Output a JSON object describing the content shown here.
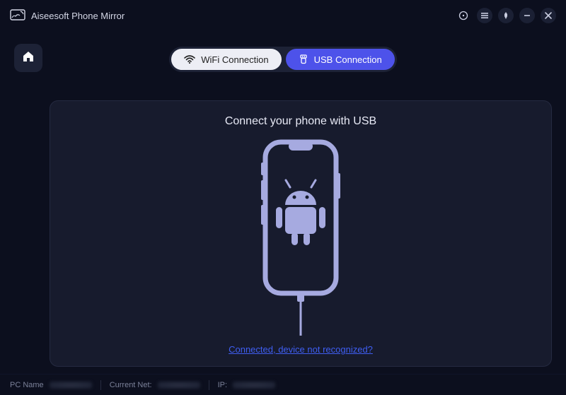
{
  "app": {
    "title": "Aiseesoft Phone Mirror"
  },
  "tabs": {
    "wifi_label": "WiFi Connection",
    "usb_label": "USB Connection"
  },
  "panel": {
    "title": "Connect your phone with USB",
    "help_link": "Connected, device not recognized?"
  },
  "statusbar": {
    "pc_name_label": "PC Name",
    "current_net_label": "Current Net:",
    "ip_label": "IP:"
  },
  "colors": {
    "accent": "#4d52ea",
    "pill_light": "#edeef5",
    "phone_fill": "#a6aae0"
  }
}
